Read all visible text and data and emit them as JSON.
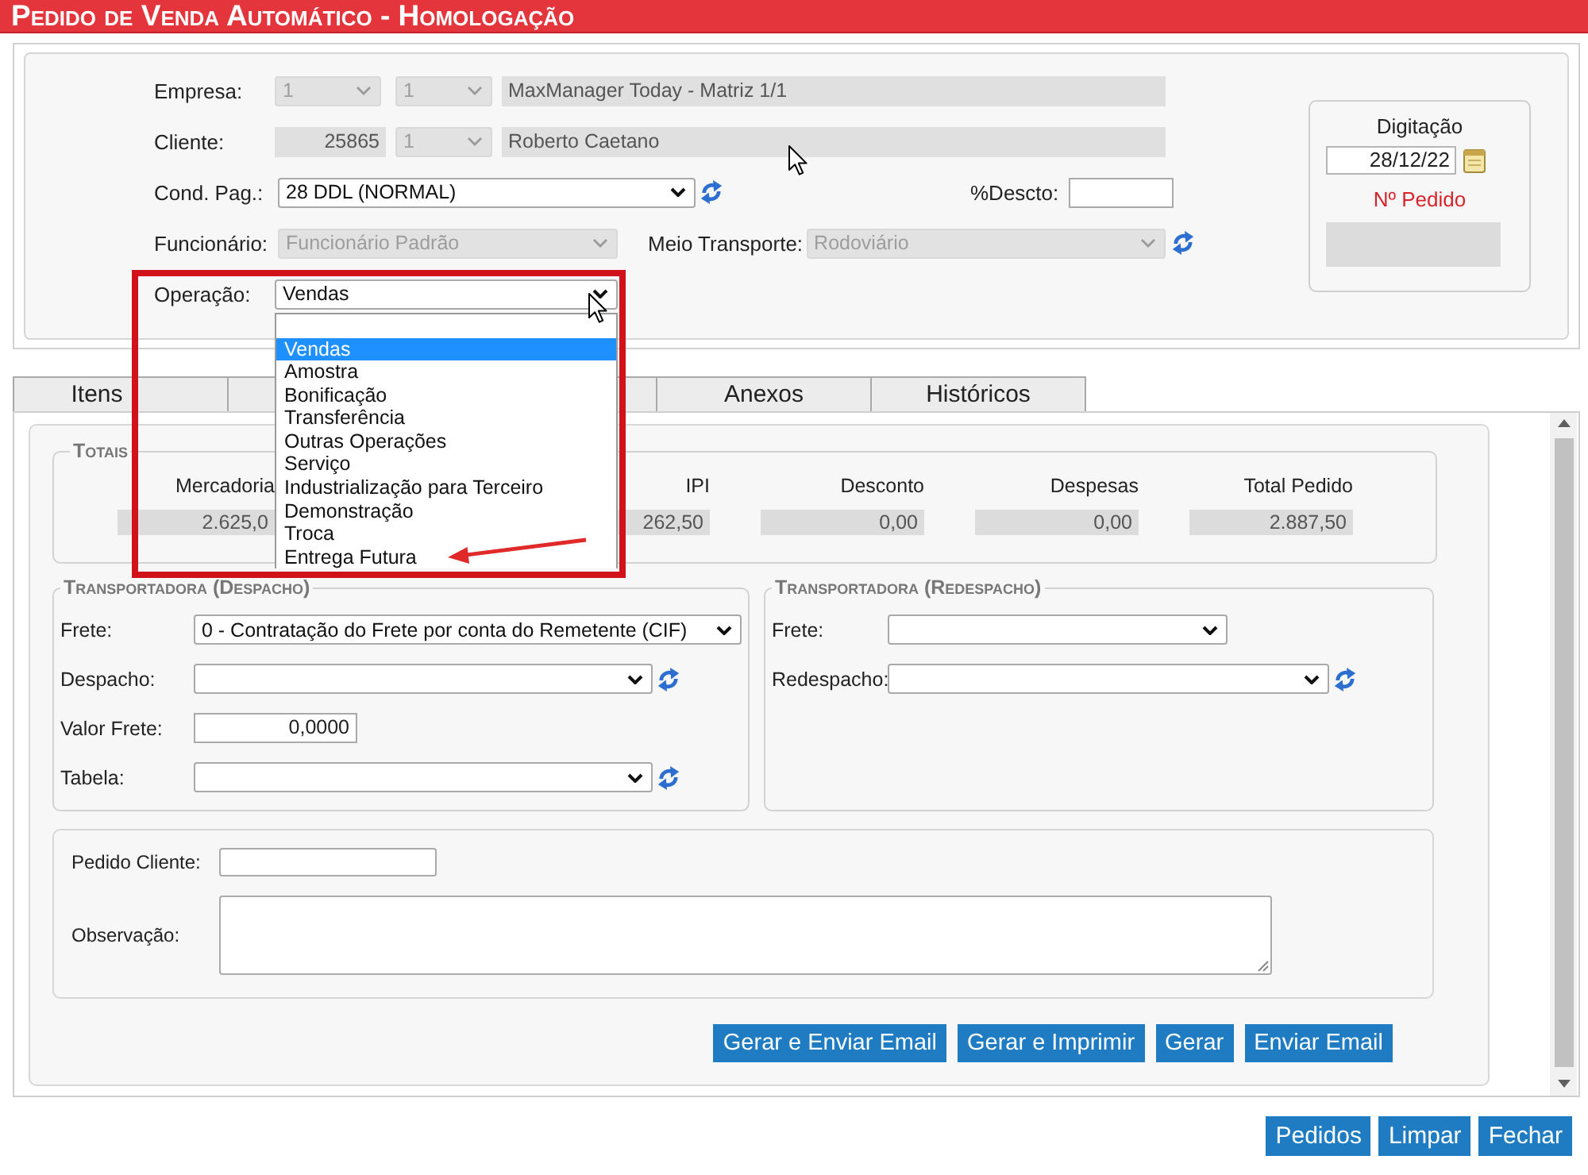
{
  "title_bar": {
    "title": "Pedido de Venda Automático - Homologação"
  },
  "order_form": {
    "rows": [
      {
        "label": "Empresa:",
        "fields": [
          {
            "kind": "select",
            "value": "1",
            "disabled": true
          },
          {
            "kind": "select",
            "value": "1",
            "disabled": true
          },
          {
            "kind": "text",
            "value": "MaxManager Today - Matriz 1/1",
            "disabled": true
          }
        ]
      },
      {
        "label": "Cliente:",
        "fields": [
          {
            "kind": "number",
            "value": "25865",
            "disabled": true
          },
          {
            "kind": "select",
            "value": "1",
            "disabled": true
          },
          {
            "kind": "text",
            "value": "Roberto Caetano",
            "disabled": true
          }
        ]
      },
      {
        "label": "Cond. Pag.:",
        "fields": [
          {
            "kind": "select",
            "value": "28 DDL (NORMAL)",
            "disabled": false,
            "refresh": true
          },
          {
            "kind": "text",
            "label": "%Descto:",
            "disabled": false
          }
        ]
      },
      {
        "label": "Funcionário:",
        "fields": [
          {
            "kind": "select",
            "value": "Funcionário Padrão",
            "disabled": true
          },
          {
            "kind": "select",
            "label": "Meio Transporte:",
            "value": "Rodoviário",
            "disabled": true,
            "refresh": true
          }
        ]
      },
      {
        "label": "Operação:",
        "fields": [
          {
            "kind": "select",
            "value": "Vendas",
            "disabled": false,
            "expanded": true,
            "options": [
              {
                "label": "Vendas",
                "selected": true
              },
              {
                "label": "Amostra",
                "selected": false
              },
              {
                "label": "Bonificação",
                "selected": false
              },
              {
                "label": "Transferência",
                "selected": false
              },
              {
                "label": "Outras Operações",
                "selected": false
              },
              {
                "label": "Serviço",
                "selected": false
              },
              {
                "label": "Industrialização para Terceiro",
                "selected": false
              },
              {
                "label": "Demonstração",
                "selected": false
              },
              {
                "label": "Troca",
                "selected": false
              },
              {
                "label": "Entrega Futura",
                "selected": false
              }
            ]
          }
        ]
      }
    ]
  },
  "digitacao": {
    "title": "Digitação",
    "date": "28/12/22",
    "order_number_label": "Nº Pedido"
  },
  "tabs": [
    {
      "label": "Itens",
      "selected": false
    },
    {
      "selected": false
    },
    {
      "selected": false
    },
    {
      "label": "Anexos",
      "selected": false
    },
    {
      "label": "Históricos",
      "selected": false
    }
  ],
  "totals": {
    "legend": "Totais",
    "items": [
      {
        "label": "Mercadoria",
        "value": "2.625,0"
      },
      {
        "label": "IPI",
        "value": "262,50"
      },
      {
        "label": "Desconto",
        "value": "0,00"
      },
      {
        "label": "Despesas",
        "value": "0,00"
      },
      {
        "label": "Total Pedido",
        "value": "2.887,50"
      }
    ]
  },
  "shipping": {
    "legend": "Transportadora (Despacho)",
    "rows": [
      {
        "kind": "select",
        "label": "Frete:",
        "value": "0 - Contratação do Frete por conta do Remetente (CIF)"
      },
      {
        "kind": "select",
        "label": "Despacho:",
        "refresh": true
      },
      {
        "kind": "number",
        "label": "Valor Frete:",
        "value": "0,0000"
      },
      {
        "kind": "select",
        "label": "Tabela:",
        "refresh": true
      }
    ]
  },
  "redispatch": {
    "legend": "Transportadora (Redespacho)",
    "rows": [
      {
        "kind": "select",
        "label": "Frete:"
      },
      {
        "kind": "select",
        "label": "Redespacho:",
        "refresh": true
      }
    ]
  },
  "notes": {
    "fields": [
      {
        "kind": "input",
        "label": "Pedido Cliente:"
      },
      {
        "kind": "textarea",
        "label": "Observação:"
      }
    ]
  },
  "actions": [
    "Gerar e Enviar Email",
    "Gerar e Imprimir",
    "Gerar",
    "Enviar Email"
  ],
  "footer_buttons": [
    "Pedidos",
    "Limpar",
    "Fechar"
  ]
}
